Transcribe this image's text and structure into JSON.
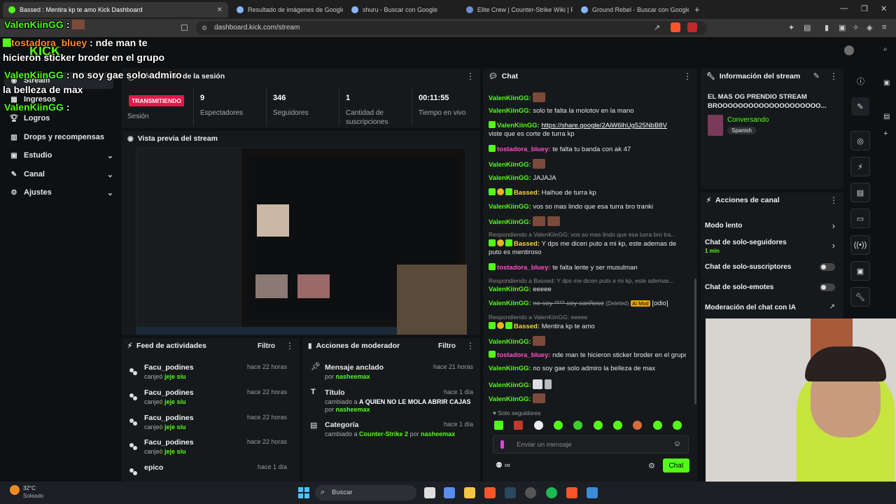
{
  "browser": {
    "tabs": [
      {
        "label": "Bassed : Mentira kp te amo Kick Dashboard"
      },
      {
        "label": "Resultado de imágenes de Google"
      },
      {
        "label": "shuru - Buscar con Google"
      },
      {
        "label": "Elite Crew | Counter-Strike Wiki | Fan"
      },
      {
        "label": "Ground Rebel - Buscar con Google"
      }
    ],
    "url": "dashboard.kick.com/stream"
  },
  "overlay": {
    "lines": [
      {
        "user": "ValenKiinGG",
        "sep": " :",
        "text": ""
      },
      {
        "user": "tostadora_bluey",
        "sep": " :",
        "text": " nde man te"
      },
      {
        "user": "",
        "sep": "",
        "text": "hicieron sticker broder en el grupo"
      },
      {
        "user": "ValenKiinGG",
        "sep": " :",
        "text": " no soy gae solo admiro"
      },
      {
        "user": "",
        "sep": "",
        "text": "la belleza de max"
      },
      {
        "user": "ValenKiinGG",
        "sep": " :",
        "text": ""
      }
    ]
  },
  "sidebar": {
    "items": [
      {
        "label": "Stream",
        "icon": "stream-icon"
      },
      {
        "label": "Ingresos",
        "icon": "money-icon"
      },
      {
        "label": "Logros",
        "icon": "trophy-icon"
      },
      {
        "label": "Drops y recompensas",
        "icon": "gift-icon"
      },
      {
        "label": "Estudio",
        "icon": "studio-icon"
      },
      {
        "label": "Canal",
        "icon": "channel-icon"
      },
      {
        "label": "Ajustes",
        "icon": "gear-icon"
      }
    ]
  },
  "session": {
    "title": "Información de la sesión",
    "live_badge": "TRANSMITIENDO",
    "session_label": "Sesión",
    "stats": [
      {
        "value": "9",
        "label": "Espectadores"
      },
      {
        "value": "346",
        "label": "Seguidores"
      },
      {
        "value": "1",
        "label": "Cantidad de suscripciones"
      },
      {
        "value": "00:11:55",
        "label": "Tiempo en vivo"
      }
    ]
  },
  "preview": {
    "title": "Vista previa del stream"
  },
  "feed": {
    "title": "Feed de actividades",
    "filter": "Filtro",
    "items": [
      {
        "name": "Facu_podines",
        "action": "canjeó",
        "reward": "jeje siu",
        "time": "hace 22 horas"
      },
      {
        "name": "Facu_podines",
        "action": "canjeó",
        "reward": "jeje siu",
        "time": "hace 22 horas"
      },
      {
        "name": "Facu_podines",
        "action": "canjeó",
        "reward": "jeje siu",
        "time": "hace 22 horas"
      },
      {
        "name": "Facu_podines",
        "action": "canjeó",
        "reward": "jeje siu",
        "time": "hace 22 horas"
      },
      {
        "name": "epico",
        "action": "",
        "reward": "",
        "time": "hace 1 día"
      }
    ]
  },
  "mod": {
    "title": "Acciones de moderador",
    "filter": "Filtro",
    "items": [
      {
        "title": "Mensaje anclado",
        "sub_pre": "por",
        "sub_val": "",
        "sub_mid": "",
        "user": "nasheemax",
        "time": "hace 21 horas",
        "icon": "pin-icon"
      },
      {
        "title": "Título",
        "sub_pre": "cambiado a",
        "sub_val": "A QUIEN NO LE MOLA ABRIR CAJAS",
        "sub_mid": "por",
        "user": "nasheemax",
        "time": "hace 1 día",
        "icon": "text-icon"
      },
      {
        "title": "Categoría",
        "sub_pre": "cambiado a",
        "sub_val": "Counter-Strike 2",
        "sub_mid": "por",
        "user": "nasheemax",
        "time": "hace 1 día",
        "icon": "category-icon"
      }
    ]
  },
  "chat": {
    "title": "Chat",
    "followers_only": "Solo seguidores",
    "input_placeholder": "Enviar un mensaje",
    "send_label": "Chat",
    "messages": [
      {
        "user": "ValenKiinGG",
        "text": "",
        "emote": true
      },
      {
        "user": "ValenKiinGG",
        "text": "solo te falta la molotov en la mano"
      },
      {
        "user": "ValenKiinGG",
        "text": "https://share.google/2AiW6lhUg525NbB8V"
      },
      {
        "user": "",
        "text": "viste que es corte de turra kp"
      },
      {
        "user": "tostadora_bluey",
        "text": "te falta tu banda con ak 47"
      },
      {
        "user": "ValenKiinGG",
        "text": "",
        "emote": true
      },
      {
        "user": "ValenKiinGG",
        "text": "JAJAJA"
      },
      {
        "user": "Bassed",
        "text": "Haihue de turra kp"
      },
      {
        "user": "ValenKiinGG",
        "text": "vos so mas lindo que esa turra bro tranki"
      },
      {
        "user": "ValenKiinGG",
        "text": "",
        "emote": true
      },
      {
        "reply": "Respondiendo a ValenKiinGG: vos so mas lindo que esa turra bro tra..."
      },
      {
        "user": "Bassed",
        "text": "Y dps me dicen puto a mi kp, este ademas de"
      },
      {
        "user": "",
        "text": "puto es mentiroso"
      },
      {
        "user": "tostadora_bluey",
        "text": "te falta lente y ser musulman"
      },
      {
        "reply": "Respondiendo a Bassed: Y dps me dicen puto a mi kp, este ademas..."
      },
      {
        "user": "ValenKiinGG",
        "text": "eeeee"
      },
      {
        "user": "ValenKiinGG",
        "text": "no soy **** soy cariñoso",
        "deleted": "(Deleted)",
        "ai": "AI Mod",
        "tag": "[odio]"
      },
      {
        "reply": "Respondiendo a ValenKiinGG: eeeee"
      },
      {
        "user": "Bassed",
        "text": "Mentira kp te amo"
      },
      {
        "user": "ValenKiinGG",
        "text": "",
        "emote": true
      },
      {
        "user": "tostadora_bluey",
        "text": "nde man te hicieron sticker broder en el grupo"
      },
      {
        "user": "ValenKiinGG",
        "text": "no soy gae solo admiro la belleza de max"
      },
      {
        "user": "ValenKiinGG",
        "text": "",
        "emote": true
      },
      {
        "user": "ValenKiinGG",
        "text": "",
        "emote": true
      }
    ]
  },
  "info": {
    "title": "Información del stream",
    "stream_title": "EL MAS OG PRENDIO STREAM BROOOOOOOOOOOOOOOOOOOO...",
    "category": "Conversando",
    "language": "Spanish"
  },
  "actions": {
    "title": "Acciones de canal",
    "items": [
      {
        "label": "Modo lento",
        "sub": "",
        "control": "chevron"
      },
      {
        "label": "Chat de solo-seguidores",
        "sub": "1 min",
        "control": "chevron"
      },
      {
        "label": "Chat de solo-suscriptores",
        "sub": "",
        "control": "toggle"
      },
      {
        "label": "Chat de solo-emotes",
        "sub": "",
        "control": "toggle"
      },
      {
        "label": "Moderación del chat con IA",
        "sub": "",
        "control": "external"
      }
    ]
  },
  "taskbar": {
    "weather_temp": "32°C",
    "weather_desc": "Soleado",
    "search": "Buscar"
  },
  "colors": {
    "accent": "#53fc18",
    "live": "#e8174a",
    "panel": "#16191c",
    "background": "#0e1113"
  }
}
